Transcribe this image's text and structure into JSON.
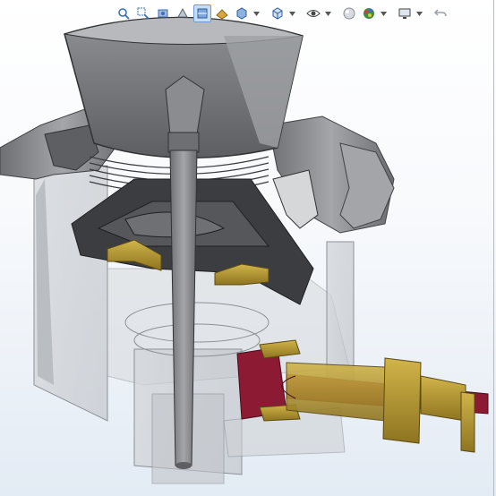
{
  "app": {
    "window": "graphics-area"
  },
  "toolbar": {
    "buttons": [
      {
        "id": "zoom-to-fit",
        "icon": "zoom-to-fit-icon"
      },
      {
        "id": "zoom-to-area",
        "icon": "zoom-to-area-icon"
      },
      {
        "id": "previous-view",
        "icon": "previous-view-icon"
      },
      {
        "id": "section-view",
        "icon": "section-view-icon",
        "active": true
      },
      {
        "id": "dynamic-annotation",
        "icon": "dynamic-annotation-icon"
      },
      {
        "id": "view-orientation",
        "icon": "view-orientation-icon",
        "dropdown": true
      },
      {
        "id": "display-style",
        "icon": "display-style-icon",
        "dropdown": true
      },
      {
        "id": "hide-show-items",
        "icon": "eye-icon",
        "dropdown": true
      },
      {
        "id": "edit-appearance",
        "icon": "edit-appearance-icon",
        "dropdown": true
      },
      {
        "id": "apply-scene",
        "icon": "apply-scene-icon",
        "dropdown": true
      },
      {
        "id": "view-settings",
        "icon": "monitor-icon",
        "dropdown": true
      },
      {
        "id": "undo",
        "icon": "undo-icon"
      }
    ]
  },
  "colors": {
    "background_top": "#ffffff",
    "background_bottom": "#e3ebf4",
    "gray_part": "#7d7f82",
    "dark_part": "#3b3d40",
    "transparent_housing": "#c9ccd1",
    "gold_part": "#b8982c",
    "red_part": "#8c1a33",
    "active_button": "#c9ddf2"
  }
}
